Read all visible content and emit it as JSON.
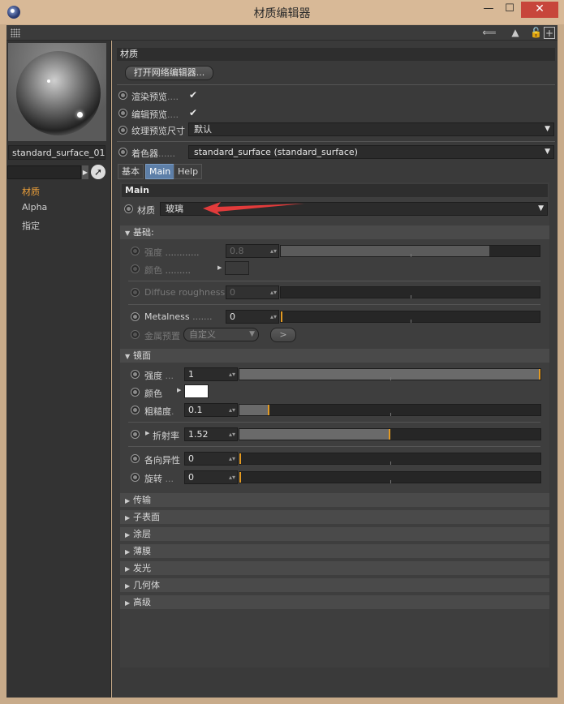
{
  "window": {
    "title": "材质编辑器",
    "min": "—",
    "max": "☐",
    "close": "✕"
  },
  "left": {
    "material_name": "standard_surface_01",
    "nav": [
      "材质",
      "Alpha",
      "指定"
    ]
  },
  "top_section": {
    "header": "材质",
    "open_node_editor": "打开网络编辑器...",
    "render_preview": "渲染预览",
    "editor_preview": "编辑预览",
    "texture_preview_size": "纹理预览尺寸",
    "texture_preview_value": "默认",
    "shader_label": "着色器",
    "shader_value": "standard_surface (standard_surface)"
  },
  "tabs": [
    "基本",
    "Main",
    "Help"
  ],
  "main": {
    "header": "Main",
    "material_label": "材质",
    "material_value": "玻璃",
    "base": {
      "header": "基础:",
      "strength_label": "强度",
      "strength_value": "0.8",
      "strength_level": 0.8,
      "color_label": "颜色",
      "diffuse_label": "Diffuse roughness",
      "diffuse_value": "0",
      "metalness_label": "Metalness",
      "metalness_value": "0",
      "metal_preset_label": "金属预置",
      "metal_preset_value": "自定义",
      "metal_preset_btn": ">"
    },
    "specular": {
      "header": "镜面",
      "strength_label": "强度",
      "strength_value": "1",
      "strength_level": 1.0,
      "color_label": "颜色",
      "color": "#ffffff",
      "roughness_label": "粗糙度",
      "roughness_value": "0.1",
      "roughness_level": 0.1,
      "ior_label": "折射率",
      "ior_value": "1.52",
      "ior_level": 0.5,
      "anisotropy_label": "各向异性",
      "anisotropy_value": "0",
      "rotation_label": "旋转",
      "rotation_value": "0"
    },
    "groups": [
      "传输",
      "子表面",
      "涂层",
      "薄膜",
      "发光",
      "几何体",
      "高级"
    ]
  },
  "colors": {
    "accent": "#e39a22",
    "active_tab": "#5d7fa8",
    "nav_active": "#f0a23a",
    "close_button": "#c7463b"
  }
}
